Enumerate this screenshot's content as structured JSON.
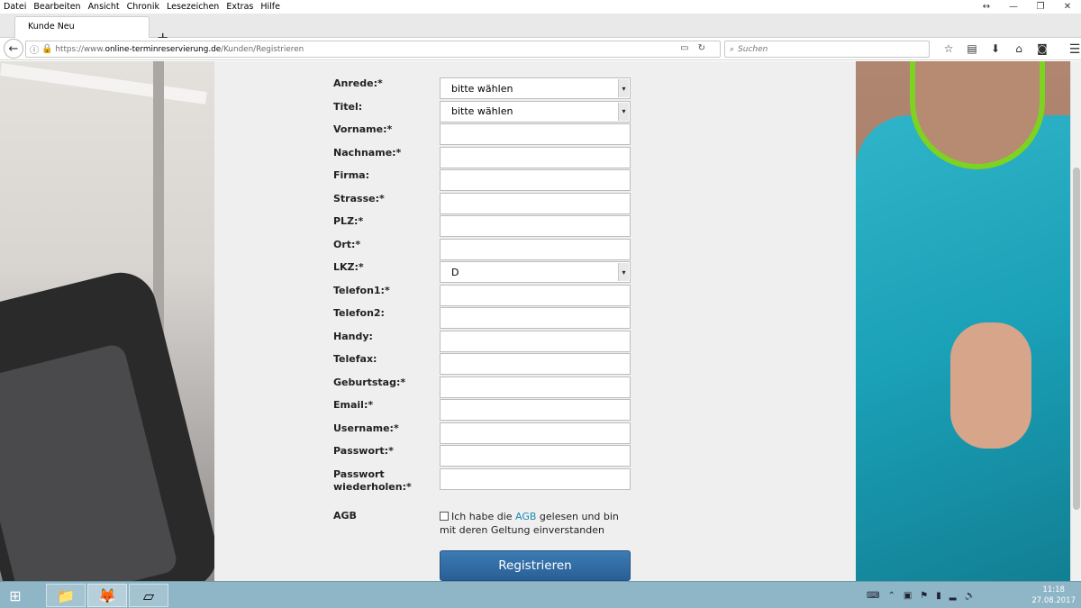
{
  "menubar": {
    "items": [
      "Datei",
      "Bearbeiten",
      "Ansicht",
      "Chronik",
      "Lesezeichen",
      "Extras",
      "Hilfe"
    ]
  },
  "tabs": [
    {
      "label": "Kunde Neu"
    }
  ],
  "nav": {
    "url_scheme": "https://www.",
    "url_host": "online-terminreservierung.de",
    "url_path": "/Kunden/Registrieren",
    "search_placeholder": "Suchen"
  },
  "form": {
    "fields": [
      {
        "label": "Anrede:*",
        "type": "select",
        "value": "bitte wählen"
      },
      {
        "label": "Titel:",
        "type": "select",
        "value": "bitte wählen"
      },
      {
        "label": "Vorname:*",
        "type": "text",
        "value": ""
      },
      {
        "label": "Nachname:*",
        "type": "text",
        "value": ""
      },
      {
        "label": "Firma:",
        "type": "text",
        "value": ""
      },
      {
        "label": "Strasse:*",
        "type": "text",
        "value": ""
      },
      {
        "label": "PLZ:*",
        "type": "text",
        "value": ""
      },
      {
        "label": "Ort:*",
        "type": "text",
        "value": ""
      },
      {
        "label": "LKZ:*",
        "type": "select",
        "value": "D"
      },
      {
        "label": "Telefon1:*",
        "type": "text",
        "value": ""
      },
      {
        "label": "Telefon2:",
        "type": "text",
        "value": ""
      },
      {
        "label": "Handy:",
        "type": "text",
        "value": ""
      },
      {
        "label": "Telefax:",
        "type": "text",
        "value": ""
      },
      {
        "label": "Geburtstag:*",
        "type": "text",
        "value": ""
      },
      {
        "label": "Email:*",
        "type": "text",
        "value": ""
      },
      {
        "label": "Username:*",
        "type": "text",
        "value": ""
      },
      {
        "label": "Passwort:*",
        "type": "text",
        "value": ""
      },
      {
        "label": "Passwort wiederholen:*",
        "type": "text",
        "value": ""
      }
    ],
    "agb_label": "AGB",
    "agb_text_before": "Ich habe die ",
    "agb_link": "AGB",
    "agb_text_after": " gelesen und bin mit deren Geltung einverstanden",
    "agb_checked": false,
    "submit_label": "Registrieren"
  },
  "taskbar": {
    "time": "11:18",
    "date": "27.08.2017"
  }
}
